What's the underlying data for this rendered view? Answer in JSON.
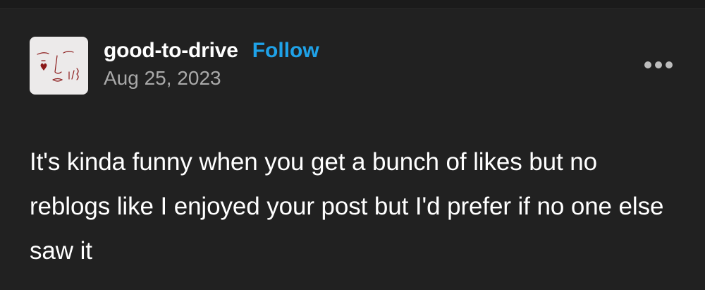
{
  "post": {
    "username": "good-to-drive",
    "follow_label": "Follow",
    "date": "Aug 25, 2023",
    "body": "It's kinda funny when you get a bunch of likes but no reblogs like I enjoyed your post but I'd prefer if no one else saw it",
    "more_icon": "ellipsis-horizontal-icon",
    "avatar_icon": "face-doodle-avatar"
  },
  "colors": {
    "background": "#212121",
    "follow_accent": "#1fa2e8",
    "date_text": "#a9a9a9",
    "avatar_ink": "#8b1a1a"
  }
}
